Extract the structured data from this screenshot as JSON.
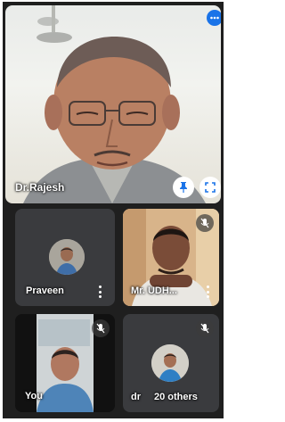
{
  "main_participant": {
    "name": "Dr.Rajesh",
    "pin_icon": "pin-icon",
    "fullscreen_icon": "fullscreen-icon",
    "audio_icon": "audio-level-icon"
  },
  "tiles": [
    {
      "name": "Praveen",
      "more_icon": "more-vert-icon"
    },
    {
      "name": "Mr. UDH...",
      "mic_icon": "mic-off-icon",
      "more_icon": "more-vert-icon"
    },
    {
      "name": "You",
      "mic_icon": "mic-off-icon"
    },
    {
      "name": "dr",
      "others_label": "20 others",
      "mic_icon": "mic-off-icon"
    }
  ],
  "colors": {
    "accent_blue": "#1a73e8",
    "tile_bg": "#3a3b3e",
    "background": "#1f1f1f"
  }
}
